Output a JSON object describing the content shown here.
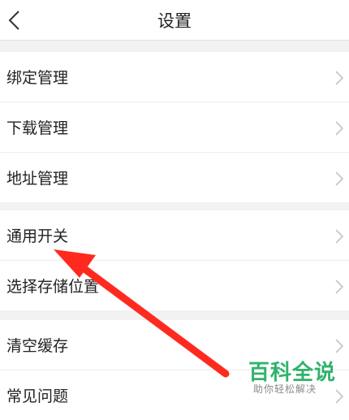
{
  "header": {
    "title": "设置",
    "back_icon": "chevron-left-icon"
  },
  "groups": [
    {
      "items": [
        {
          "label": "绑定管理"
        },
        {
          "label": "下载管理"
        },
        {
          "label": "地址管理"
        }
      ]
    },
    {
      "items": [
        {
          "label": "通用开关"
        },
        {
          "label": "选择存储位置"
        }
      ]
    },
    {
      "items": [
        {
          "label": "清空缓存"
        },
        {
          "label": "常见问题"
        }
      ]
    }
  ],
  "watermark": {
    "brand": "百科全说",
    "tagline": "助你轻松解决"
  },
  "colors": {
    "annotation_arrow": "#ff2a1f",
    "watermark_green": "#2fb36b"
  }
}
